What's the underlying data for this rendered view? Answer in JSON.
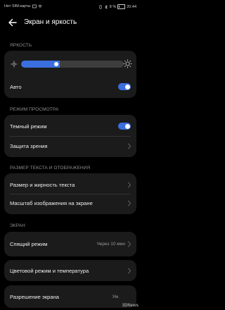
{
  "status_bar": {
    "carrier": "Нет SIM-карты",
    "battery": "8 %",
    "time": "20:44"
  },
  "header": {
    "title": "Экран и яркость"
  },
  "brightness": {
    "section_label": "ЯРКОСТЬ",
    "level": 0.38,
    "auto_label": "Авто",
    "auto_on": true
  },
  "view_mode": {
    "section_label": "РЕЖИМ ПРОСМОТРА",
    "dark_mode_label": "Темный режим",
    "dark_mode_on": true,
    "eye_comfort_label": "Защита зрения"
  },
  "text_display": {
    "section_label": "РАЗМЕР ТЕКСТА И ОТОБРАЖЕНИЯ",
    "text_size_label": "Размер и жирность текста",
    "display_scale_label": "Масштаб изображения на экране"
  },
  "screen": {
    "section_label": "ЭКРАН",
    "sleep_label": "Спящий режим",
    "sleep_value": "Через 10 мин",
    "color_mode_label": "Цветовой режим и температура",
    "resolution_label": "Разрешение экрана",
    "resolution_value": "Ум"
  },
  "watermark": "3DNews",
  "colors": {
    "accent": "#3b6fe0",
    "card": "#1b1b1b",
    "background": "#000000"
  },
  "icons": [
    "back-arrow-icon",
    "sun-low-icon",
    "sun-high-icon",
    "chevron-right-icon",
    "battery-icon",
    "wifi-icon",
    "signal-icon"
  ]
}
